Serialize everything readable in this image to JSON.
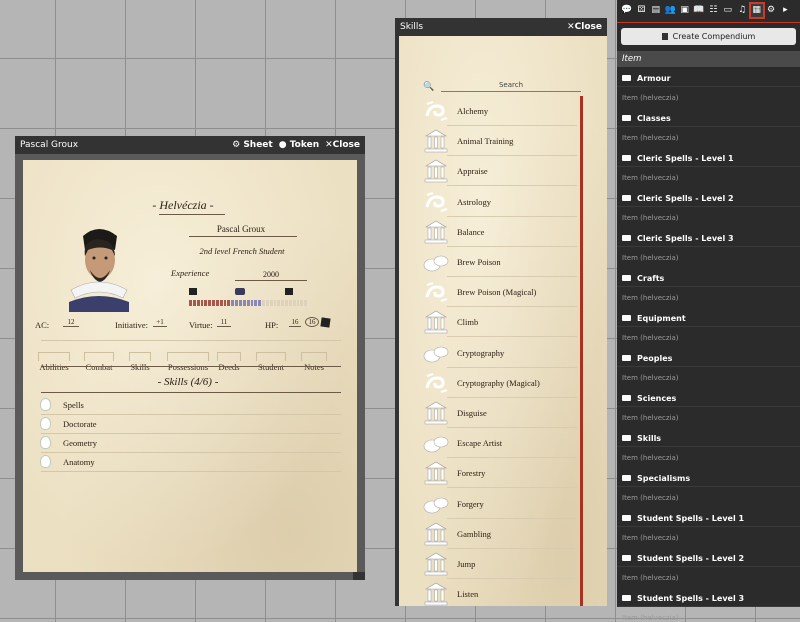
{
  "character_window": {
    "title": "Pascal Groux",
    "sheet_label": "Sheet",
    "token_label": "Token",
    "close_label": "Close",
    "game_title": "- Helvéczia -",
    "char_name": "Pascal Groux",
    "char_desc": "2nd level French Student",
    "experience_label": "Experience",
    "experience_value": "2000",
    "ac_label": "AC:",
    "ac_value": "12",
    "initiative_label": "Initiative:",
    "initiative_value": "+1",
    "virtue_label": "Virtue:",
    "virtue_value": "11",
    "hp_label": "HP:",
    "hp_current": "16",
    "hp_max": "16",
    "tabs": [
      "Abilities",
      "Combat",
      "Skills",
      "Possessions",
      "Deeds",
      "Student",
      "Notes"
    ],
    "skills_heading": "- Skills (4/6) -",
    "skills": [
      "Spells",
      "Doctorate",
      "Geometry",
      "Anatomy"
    ],
    "xp_bar": {
      "red_segments": 11,
      "purple_segments": 8,
      "empty_segments": 12
    }
  },
  "skills_window": {
    "title": "Skills",
    "close_label": "Close",
    "search_placeholder": "Search",
    "items": [
      {
        "label": "Alchemy",
        "icon": "swirl-icon"
      },
      {
        "label": "Animal Training",
        "icon": "temple-icon"
      },
      {
        "label": "Appraise",
        "icon": "temple-icon"
      },
      {
        "label": "Astrology",
        "icon": "swirl-icon"
      },
      {
        "label": "Balance",
        "icon": "temple-icon"
      },
      {
        "label": "Brew Poison",
        "icon": "stones-icon"
      },
      {
        "label": "Brew Poison (Magical)",
        "icon": "swirl-icon"
      },
      {
        "label": "Climb",
        "icon": "temple-icon"
      },
      {
        "label": "Cryptography",
        "icon": "stones-icon"
      },
      {
        "label": "Cryptography (Magical)",
        "icon": "swirl-icon"
      },
      {
        "label": "Disguise",
        "icon": "temple-icon"
      },
      {
        "label": "Escape Artist",
        "icon": "stones-icon"
      },
      {
        "label": "Forestry",
        "icon": "temple-icon"
      },
      {
        "label": "Forgery",
        "icon": "stones-icon"
      },
      {
        "label": "Gambling",
        "icon": "temple-icon"
      },
      {
        "label": "Jump",
        "icon": "temple-icon"
      },
      {
        "label": "Listen",
        "icon": "temple-icon"
      }
    ]
  },
  "sidebar": {
    "tab_icons": [
      "chat-icon",
      "dice-icon",
      "map-icon",
      "people-icon",
      "box-icon",
      "book-icon",
      "grid-icon",
      "card-icon",
      "music-icon",
      "compendium-icon",
      "settings-icon",
      "arrow-right-icon"
    ],
    "create_label": "Create Compendium",
    "item_header": "Item",
    "folders": [
      {
        "name": "Armour",
        "sub": "Item (helveczia)"
      },
      {
        "name": "Classes",
        "sub": "Item (helveczia)"
      },
      {
        "name": "Cleric Spells - Level 1",
        "sub": "Item (helveczia)"
      },
      {
        "name": "Cleric Spells - Level 2",
        "sub": "Item (helveczia)"
      },
      {
        "name": "Cleric Spells - Level 3",
        "sub": "Item (helveczia)"
      },
      {
        "name": "Crafts",
        "sub": "Item (helveczia)"
      },
      {
        "name": "Equipment",
        "sub": "Item (helveczia)"
      },
      {
        "name": "Peoples",
        "sub": "Item (helveczia)"
      },
      {
        "name": "Sciences",
        "sub": "Item (helveczia)"
      },
      {
        "name": "Skills",
        "sub": "Item (helveczia)"
      },
      {
        "name": "Specialisms",
        "sub": "Item (helveczia)"
      },
      {
        "name": "Student Spells - Level 1",
        "sub": "Item (helveczia)"
      },
      {
        "name": "Student Spells - Level 2",
        "sub": "Item (helveczia)"
      },
      {
        "name": "Student Spells - Level 3",
        "sub": "Item (helveczia)"
      }
    ]
  },
  "colors": {
    "accent": "#cc3b28",
    "parchment": "#ece0c2",
    "titlebar": "#333333"
  }
}
